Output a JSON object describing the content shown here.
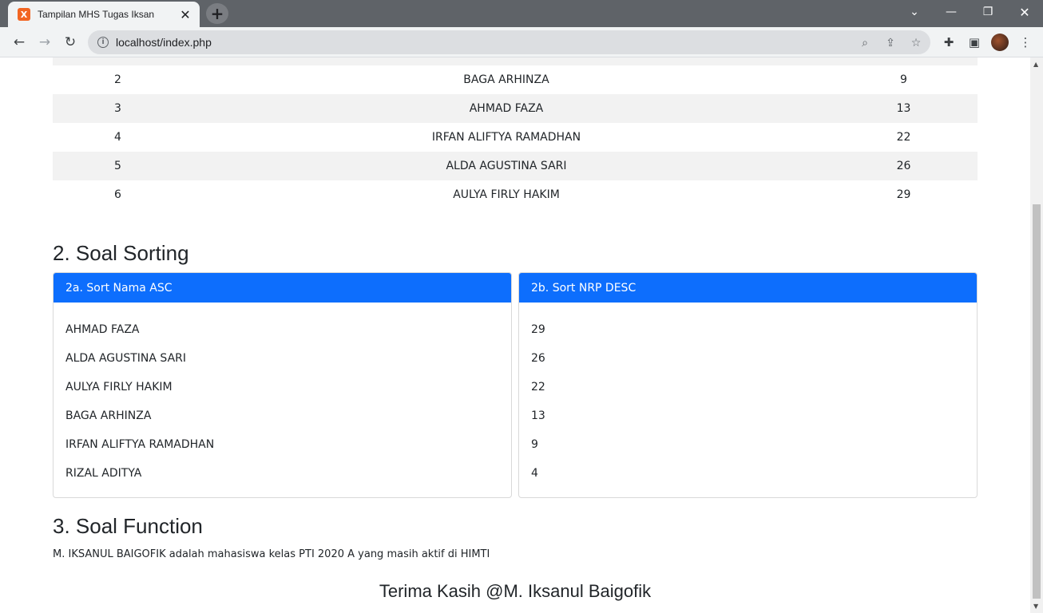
{
  "browser": {
    "tab_title": "Tampilan MHS Tugas Iksan",
    "favicon_letter": "X",
    "url": "localhost/index.php"
  },
  "table": {
    "rows": [
      {
        "no": "2",
        "nama": "BAGA ARHINZA",
        "nrp": "9"
      },
      {
        "no": "3",
        "nama": "AHMAD FAZA",
        "nrp": "13"
      },
      {
        "no": "4",
        "nama": "IRFAN ALIFTYA RAMADHAN",
        "nrp": "22"
      },
      {
        "no": "5",
        "nama": "ALDA AGUSTINA SARI",
        "nrp": "26"
      },
      {
        "no": "6",
        "nama": "AULYA FIRLY HAKIM",
        "nrp": "29"
      }
    ]
  },
  "sorting": {
    "heading": "2. Soal Sorting",
    "asc": {
      "title": "2a. Sort Nama ASC",
      "items": [
        "AHMAD FAZA",
        "ALDA AGUSTINA SARI",
        "AULYA FIRLY HAKIM",
        "BAGA ARHINZA",
        "IRFAN ALIFTYA RAMADHAN",
        "RIZAL ADITYA"
      ]
    },
    "desc": {
      "title": "2b. Sort NRP DESC",
      "items": [
        "29",
        "26",
        "22",
        "13",
        "9",
        "4"
      ]
    }
  },
  "function": {
    "heading": "3. Soal Function",
    "text": "M. IKSANUL BAIGOFIK adalah mahasiswa kelas PTI 2020 A yang masih aktif di HIMTI"
  },
  "footer": {
    "thanks": "Terima Kasih @M. Iksanul Baigofik"
  },
  "colors": {
    "card_header": "#0d6efd",
    "stripe": "#f2f2f2"
  }
}
